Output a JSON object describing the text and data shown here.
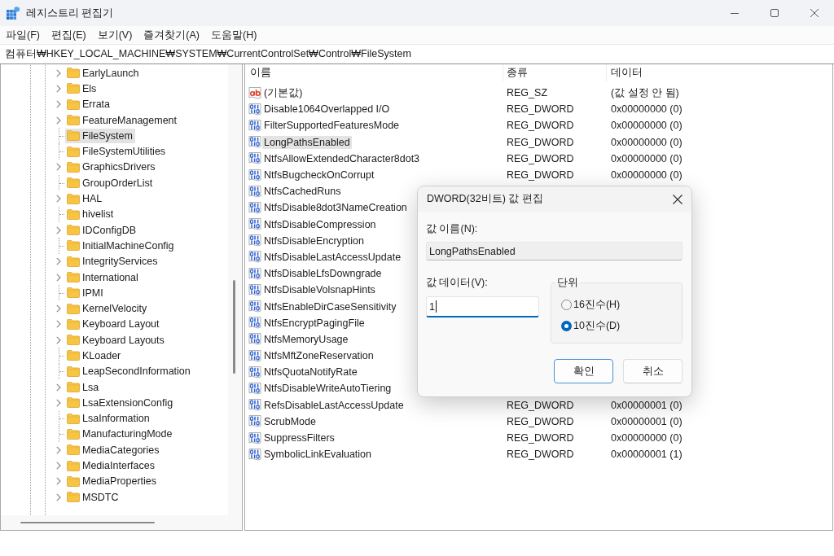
{
  "window": {
    "title": "레지스트리 편집기"
  },
  "menu": [
    "파일(F)",
    "편집(E)",
    "보기(V)",
    "즐겨찾기(A)",
    "도움말(H)"
  ],
  "address": "컴퓨터₩HKEY_LOCAL_MACHINE₩SYSTEM₩CurrentControlSet₩Control₩FileSystem",
  "tree": {
    "items": [
      {
        "label": "EarlyLaunch",
        "has_children": true,
        "selected": false
      },
      {
        "label": "Els",
        "has_children": true,
        "selected": false
      },
      {
        "label": "Errata",
        "has_children": true,
        "selected": false
      },
      {
        "label": "FeatureManagement",
        "has_children": true,
        "selected": false
      },
      {
        "label": "FileSystem",
        "has_children": false,
        "selected": true
      },
      {
        "label": "FileSystemUtilities",
        "has_children": false,
        "selected": false
      },
      {
        "label": "GraphicsDrivers",
        "has_children": true,
        "selected": false
      },
      {
        "label": "GroupOrderList",
        "has_children": false,
        "selected": false
      },
      {
        "label": "HAL",
        "has_children": true,
        "selected": false
      },
      {
        "label": "hivelist",
        "has_children": false,
        "selected": false
      },
      {
        "label": "IDConfigDB",
        "has_children": true,
        "selected": false
      },
      {
        "label": "InitialMachineConfig",
        "has_children": false,
        "selected": false
      },
      {
        "label": "IntegrityServices",
        "has_children": true,
        "selected": false
      },
      {
        "label": "International",
        "has_children": true,
        "selected": false
      },
      {
        "label": "IPMI",
        "has_children": false,
        "selected": false
      },
      {
        "label": "KernelVelocity",
        "has_children": true,
        "selected": false
      },
      {
        "label": "Keyboard Layout",
        "has_children": true,
        "selected": false
      },
      {
        "label": "Keyboard Layouts",
        "has_children": true,
        "selected": false
      },
      {
        "label": "KLoader",
        "has_children": false,
        "selected": false
      },
      {
        "label": "LeapSecondInformation",
        "has_children": false,
        "selected": false
      },
      {
        "label": "Lsa",
        "has_children": true,
        "selected": false
      },
      {
        "label": "LsaExtensionConfig",
        "has_children": true,
        "selected": false
      },
      {
        "label": "LsaInformation",
        "has_children": false,
        "selected": false
      },
      {
        "label": "ManufacturingMode",
        "has_children": false,
        "selected": false
      },
      {
        "label": "MediaCategories",
        "has_children": true,
        "selected": false
      },
      {
        "label": "MediaInterfaces",
        "has_children": true,
        "selected": false
      },
      {
        "label": "MediaProperties",
        "has_children": true,
        "selected": false
      },
      {
        "label": "MSDTC",
        "has_children": true,
        "selected": false
      }
    ]
  },
  "values": {
    "columns": [
      "이름",
      "종류",
      "데이터"
    ],
    "rows": [
      {
        "kind": "string",
        "name": "(기본값)",
        "type": "REG_SZ",
        "data": "(값 설정 안 됨)",
        "selected": false
      },
      {
        "kind": "dword",
        "name": "Disable1064Overlapped I/O",
        "type": "REG_DWORD",
        "data": "0x00000000 (0)",
        "selected": false
      },
      {
        "kind": "dword",
        "name": "FilterSupportedFeaturesMode",
        "type": "REG_DWORD",
        "data": "0x00000000 (0)",
        "selected": false
      },
      {
        "kind": "dword",
        "name": "LongPathsEnabled",
        "type": "REG_DWORD",
        "data": "0x00000000 (0)",
        "selected": true
      },
      {
        "kind": "dword",
        "name": "NtfsAllowExtendedCharacter8dot3",
        "type": "REG_DWORD",
        "data": "0x00000000 (0)",
        "selected": false
      },
      {
        "kind": "dword",
        "name": "NtfsBugcheckOnCorrupt",
        "type": "REG_DWORD",
        "data": "0x00000000 (0)",
        "selected": false
      },
      {
        "kind": "dword",
        "name": "NtfsCachedRuns",
        "selected": false
      },
      {
        "kind": "dword",
        "name": "NtfsDisable8dot3NameCreation",
        "selected": false
      },
      {
        "kind": "dword",
        "name": "NtfsDisableCompression",
        "selected": false
      },
      {
        "kind": "dword",
        "name": "NtfsDisableEncryption",
        "selected": false
      },
      {
        "kind": "dword",
        "name": "NtfsDisableLastAccessUpdate",
        "selected": false
      },
      {
        "kind": "dword",
        "name": "NtfsDisableLfsDowngrade",
        "selected": false
      },
      {
        "kind": "dword",
        "name": "NtfsDisableVolsnapHints",
        "selected": false
      },
      {
        "kind": "dword",
        "name": "NtfsEnableDirCaseSensitivity",
        "selected": false
      },
      {
        "kind": "dword",
        "name": "NtfsEncryptPagingFile",
        "selected": false
      },
      {
        "kind": "dword",
        "name": "NtfsMemoryUsage",
        "selected": false
      },
      {
        "kind": "dword",
        "name": "NtfsMftZoneReservation",
        "selected": false
      },
      {
        "kind": "dword",
        "name": "NtfsQuotaNotifyRate",
        "selected": false
      },
      {
        "kind": "dword",
        "name": "NtfsDisableWriteAutoTiering",
        "selected": false
      },
      {
        "kind": "dword",
        "name": "RefsDisableLastAccessUpdate",
        "type": "REG_DWORD",
        "data": "0x00000001 (0)",
        "selected": false
      },
      {
        "kind": "dword",
        "name": "ScrubMode",
        "type": "REG_DWORD",
        "data": "0x00000001 (0)",
        "selected": false
      },
      {
        "kind": "dword",
        "name": "SuppressFilters",
        "type": "REG_DWORD",
        "data": "0x00000000 (0)",
        "selected": false
      },
      {
        "kind": "dword",
        "name": "SymbolicLinkEvaluation",
        "type": "REG_DWORD",
        "data": "0x00000001 (1)",
        "selected": false
      }
    ]
  },
  "dialog": {
    "title": "DWORD(32비트) 값 편집",
    "name_label": "값 이름(N):",
    "name_value": "LongPathsEnabled",
    "data_label": "값 데이터(V):",
    "data_value": "1",
    "base": {
      "title": "단위",
      "options": [
        {
          "label": "16진수(H)",
          "selected": false
        },
        {
          "label": "10진수(D)",
          "selected": true
        }
      ]
    },
    "buttons": [
      {
        "label": "확인",
        "default": true
      },
      {
        "label": "취소",
        "default": false
      }
    ]
  }
}
